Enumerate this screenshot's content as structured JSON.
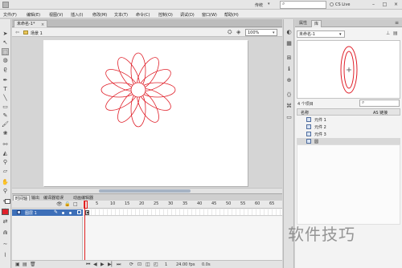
{
  "titlebar": {
    "workspace": "传统",
    "cs_live": "CS Live",
    "win_minimize": "–",
    "win_maximize": "□",
    "win_close": "×"
  },
  "menus": [
    "文件(F)",
    "编辑(E)",
    "视图(V)",
    "插入(I)",
    "修改(M)",
    "文本(T)",
    "命令(C)",
    "控制(O)",
    "调试(D)",
    "窗口(W)",
    "帮助(H)"
  ],
  "document": {
    "tab_label": "未命名-1*",
    "tab_close": "×",
    "scene_label": "场景 1",
    "zoom": "100%"
  },
  "stage": {
    "background": "#ffffff",
    "figure_color": "#e0202a",
    "petal_count": 12
  },
  "timeline": {
    "tabs": [
      "时间轴",
      "输出",
      "编译器错误",
      "动画编辑器"
    ],
    "layer_name": "图层 1",
    "ruler_numbers": [
      "5",
      "10",
      "15",
      "20",
      "25",
      "30",
      "35",
      "40",
      "45",
      "50",
      "55",
      "60",
      "65"
    ],
    "status": {
      "frame": "1",
      "fps": "24.00 fps",
      "time": "0.0s"
    }
  },
  "library": {
    "tabs": [
      "属性",
      "库"
    ],
    "document": "未命名-1",
    "item_count": "4 个项目",
    "columns": {
      "name": "名称",
      "linkage": "AS 链接"
    },
    "items": [
      {
        "label": "元件 1"
      },
      {
        "label": "元件 2"
      },
      {
        "label": "元件 3"
      },
      {
        "label": "圆"
      }
    ]
  },
  "watermark": "软件技巧",
  "colors": {
    "accent": "#3d6fb8",
    "stroke": "#e0202a",
    "fill_swatch": "#e0202a"
  }
}
